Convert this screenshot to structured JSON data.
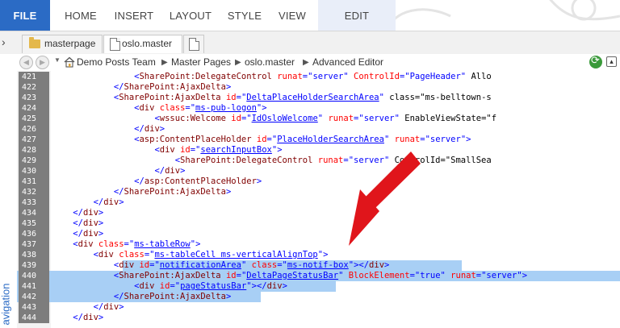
{
  "ribbon": {
    "tabs": [
      {
        "label": "FILE"
      },
      {
        "label": "HOME"
      },
      {
        "label": "INSERT"
      },
      {
        "label": "LAYOUT"
      },
      {
        "label": "STYLE"
      },
      {
        "label": "VIEW"
      },
      {
        "label": "EDIT"
      }
    ]
  },
  "doc_tabs": {
    "tabs": [
      {
        "label": "masterpage"
      },
      {
        "label": "oslo.master"
      }
    ]
  },
  "breadcrumb": {
    "items": [
      "Demo Posts Team",
      "Master Pages",
      "oslo.master",
      "Advanced Editor"
    ]
  },
  "left_nav": {
    "label": "avigation"
  },
  "code": {
    "lines": [
      {
        "n": "421",
        "text": "                <SharePoint:DelegateControl runat=\"server\" ControlId=\"PageHeader\" Allo"
      },
      {
        "n": "422",
        "text": "            </SharePoint:AjaxDelta>"
      },
      {
        "n": "423",
        "text": "            <SharePoint:AjaxDelta id=\"DeltaPlaceHolderSearchArea\" class=\"ms-belltown-s"
      },
      {
        "n": "424",
        "text": "                <div class=\"ms-pub-logon\">"
      },
      {
        "n": "425",
        "text": "                    <wssuc:Welcome id=\"IdOsloWelcome\" runat=\"server\" EnableViewState=\"f"
      },
      {
        "n": "426",
        "text": "                </div>"
      },
      {
        "n": "427",
        "text": "                <asp:ContentPlaceHolder id=\"PlaceHolderSearchArea\" runat=\"server\">"
      },
      {
        "n": "428",
        "text": "                    <div id=\"searchInputBox\">"
      },
      {
        "n": "429",
        "text": "                        <SharePoint:DelegateControl runat=\"server\" ControlId=\"SmallSea"
      },
      {
        "n": "430",
        "text": "                    </div>"
      },
      {
        "n": "431",
        "text": "                </asp:ContentPlaceHolder>"
      },
      {
        "n": "432",
        "text": "            </SharePoint:AjaxDelta>"
      },
      {
        "n": "433",
        "text": "        </div>"
      },
      {
        "n": "434",
        "text": "    </div>"
      },
      {
        "n": "435",
        "text": "    </div>"
      },
      {
        "n": "436",
        "text": "    </div>"
      },
      {
        "n": "437",
        "text": "    <div class=\"ms-tableRow\">"
      },
      {
        "n": "438",
        "text": "        <div class=\"ms-tableCell ms-verticalAlignTop\">"
      },
      {
        "n": "439",
        "text": "            <div id=\"notificationArea\" class=\"ms-notif-box\"></div>"
      },
      {
        "n": "440",
        "text": "            <SharePoint:AjaxDelta id=\"DeltaPageStatusBar\" BlockElement=\"true\" runat=\"server\">"
      },
      {
        "n": "441",
        "text": "                <div id=\"pageStatusBar\"></div>"
      },
      {
        "n": "442",
        "text": "            </SharePoint:AjaxDelta>"
      },
      {
        "n": "443",
        "text": "        </div>"
      },
      {
        "n": "444",
        "text": "    </div>"
      }
    ]
  },
  "colors": {
    "accent": "#2b6bc5",
    "selection": "#a8cff5",
    "tag": "#800000",
    "attribute": "#ff0000",
    "value": "#0000ff",
    "arrow": "#e0151b"
  }
}
